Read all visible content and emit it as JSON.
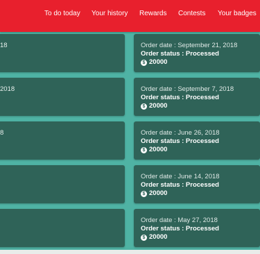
{
  "nav": {
    "items": [
      {
        "label": "To do today"
      },
      {
        "label": "Your history"
      },
      {
        "label": "Rewards"
      },
      {
        "label": "Contests"
      },
      {
        "label": "Your badges"
      }
    ]
  },
  "orders": [
    {
      "left_fragment": "18",
      "date_label": "Order date : September 21, 2018",
      "status_label": "Order status : Processed",
      "amount": "20000",
      "coin_symbol": "$"
    },
    {
      "left_fragment": "2018",
      "date_label": "Order date : September 7, 2018",
      "status_label": "Order status : Processed",
      "amount": "20000",
      "coin_symbol": "$"
    },
    {
      "left_fragment": "8",
      "date_label": "Order date : June 26, 2018",
      "status_label": "Order status : Processed",
      "amount": "20000",
      "coin_symbol": "$"
    },
    {
      "left_fragment": "",
      "date_label": "Order date : June 14, 2018",
      "status_label": "Order status : Processed",
      "amount": "20000",
      "coin_symbol": "$"
    },
    {
      "left_fragment": "",
      "date_label": "Order date : May 27, 2018",
      "status_label": "Order status : Processed",
      "amount": "20000",
      "coin_symbol": "$"
    }
  ],
  "colors": {
    "header": "#e8202d",
    "background": "#4fb3a4",
    "card": "#2f6358",
    "text": "#ffffff"
  },
  "icons": {
    "coin": "dollar-coin-icon"
  }
}
